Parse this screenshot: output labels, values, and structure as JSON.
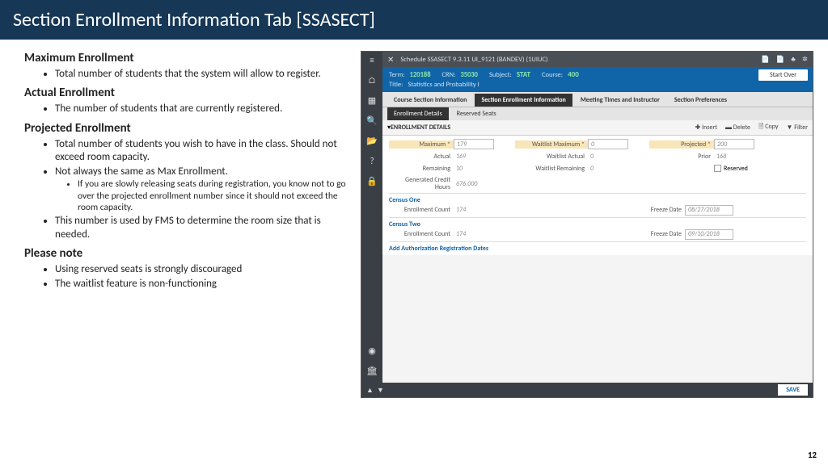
{
  "slide": {
    "title": "Section Enrollment Information Tab  [SSASECT]",
    "page_number": "12"
  },
  "doc": {
    "h1": "Maximum Enrollment",
    "h1_b1": "Total number of students that the system will allow to register.",
    "h2": "Actual Enrollment",
    "h2_b1": "The number of students that are currently registered.",
    "h3": "Projected Enrollment",
    "h3_b1": "Total number of students you wish to have in the class. Should not exceed room capacity.",
    "h3_b2": "Not always the same as Max Enrollment.",
    "h3_b2_s1": "If you are slowly releasing seats during registration, you know not to go over the projected enrollment number since it should not exceed the room capacity.",
    "h3_b3": "This number is used by FMS to determine the room size that is needed.",
    "h4": "Please note",
    "h4_b1": "Using reserved seats is strongly discouraged",
    "h4_b2": "The waitlist feature is non-functioning"
  },
  "app": {
    "window_title": "Schedule SSASECT 9.3.11 UI_9121 (BANDEV) (1UIUC)",
    "header": {
      "term_l": "Term:",
      "term_v": "120188",
      "crn_l": "CRN:",
      "crn_v": "35030",
      "subject_l": "Subject:",
      "subject_v": "STAT",
      "course_l": "Course:",
      "course_v": "400",
      "title_l": "Title:",
      "title_v": "Statistics and Probability I",
      "start_over": "Start Over"
    },
    "tabs": {
      "t1": "Course Section Information",
      "t2": "Section Enrollment Information",
      "t3": "Meeting Times and Instructor",
      "t4": "Section Preferences",
      "s1": "Enrollment Details",
      "s2": "Reserved Seats"
    },
    "toolbar": {
      "title": "ENROLLMENT DETAILS",
      "insert": "Insert",
      "delete": "Delete",
      "copy": "Copy",
      "filter": "Filter"
    },
    "fields": {
      "max_l": "Maximum *",
      "max_v": "179",
      "actual_l": "Actual",
      "actual_v": "169",
      "remain_l": "Remaining",
      "remain_v": "10",
      "wmax_l": "Waitlist Maximum *",
      "wmax_v": "0",
      "wact_l": "Waitlist Actual",
      "wact_v": "0",
      "wrem_l": "Waitlist Remaining",
      "wrem_v": "0",
      "proj_l": "Projected *",
      "proj_v": "200",
      "prior_l": "Prior",
      "prior_v": "168",
      "resv_l": "Reserved",
      "gch_l": "Generated Credit Hours",
      "gch_v": "676.000",
      "c1": "Census One",
      "c1_ec_l": "Enrollment Count",
      "c1_ec_v": "174",
      "c1_fd_l": "Freeze Date",
      "c1_fd_v": "08/27/2018",
      "c2": "Census Two",
      "c2_ec_l": "Enrollment Count",
      "c2_ec_v": "174",
      "c2_fd_l": "Freeze Date",
      "c2_fd_v": "09/10/2018",
      "auth": "Add Authorization Registration Dates"
    },
    "save": "SAVE"
  }
}
